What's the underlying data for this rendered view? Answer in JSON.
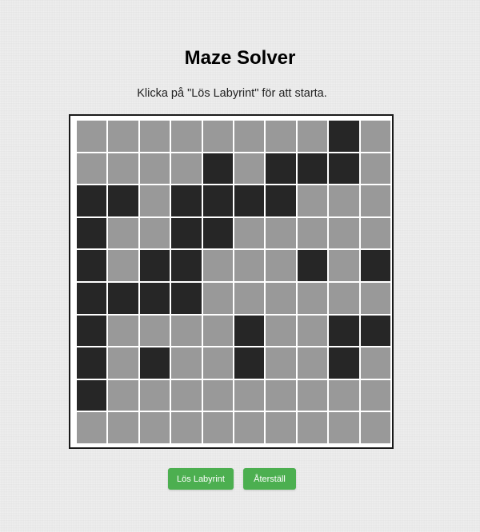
{
  "title": "Maze Solver",
  "status": "Klicka på \"Lös Labyrint\" för att starta.",
  "buttons": {
    "solve_label": "Lös Labyrint",
    "reset_label": "Återställ"
  },
  "colors": {
    "path": "#999999",
    "wall": "#262626",
    "button": "#4caf50"
  },
  "maze": {
    "rows": 10,
    "cols": 10,
    "cells": [
      [
        0,
        0,
        0,
        0,
        0,
        0,
        0,
        0,
        1,
        0
      ],
      [
        0,
        0,
        0,
        0,
        1,
        0,
        1,
        1,
        1,
        0
      ],
      [
        1,
        1,
        0,
        1,
        1,
        1,
        1,
        0,
        0,
        0
      ],
      [
        1,
        0,
        0,
        1,
        1,
        0,
        0,
        0,
        0,
        0
      ],
      [
        1,
        0,
        1,
        1,
        0,
        0,
        0,
        1,
        0,
        1
      ],
      [
        1,
        1,
        1,
        1,
        0,
        0,
        0,
        0,
        0,
        0
      ],
      [
        1,
        0,
        0,
        0,
        0,
        1,
        0,
        0,
        1,
        1
      ],
      [
        1,
        0,
        1,
        0,
        0,
        1,
        0,
        0,
        1,
        0
      ],
      [
        1,
        0,
        0,
        0,
        0,
        0,
        0,
        0,
        0,
        0
      ],
      [
        0,
        0,
        0,
        0,
        0,
        0,
        0,
        0,
        0,
        0
      ]
    ]
  }
}
